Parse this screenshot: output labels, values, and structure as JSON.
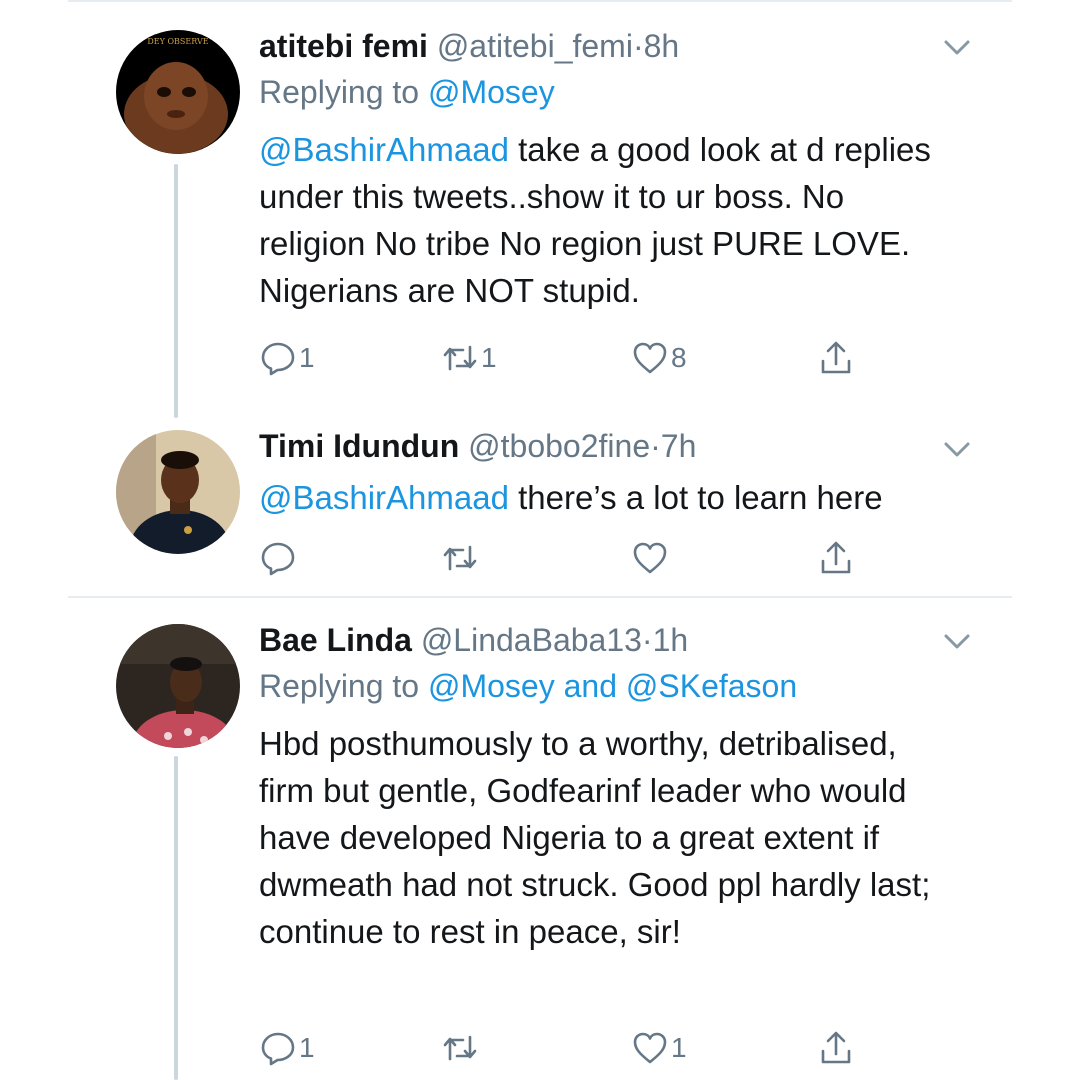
{
  "colors": {
    "link": "#1b95e0",
    "muted": "#657786",
    "text": "#14171a",
    "divider": "#e6ecf0"
  },
  "tweets": [
    {
      "name": "atitebi femi",
      "handle": "@atitebi_femi",
      "dot": "·",
      "time": "8h",
      "replying_prefix": "Replying to",
      "replying_users": "@Mosey",
      "mention": "@BashirAhmaad",
      "text": " take a good look at d replies under this tweets..show it to ur boss. No religion No tribe No region just PURE LOVE. Nigerians are NOT stupid.",
      "avatar_caption": "DEY OBSERVE",
      "reply_count": "1",
      "retweet_count": "1",
      "like_count": "8"
    },
    {
      "name": "Timi Idundun",
      "handle": "@tbobo2fine",
      "dot": "·",
      "time": "7h",
      "mention": "@BashirAhmaad",
      "text": " there’s a lot to learn here",
      "reply_count": "",
      "retweet_count": "",
      "like_count": ""
    },
    {
      "name": "Bae Linda",
      "handle": "@LindaBaba13",
      "dot": "·",
      "time": "1h",
      "replying_prefix": "Replying to",
      "replying_users": "@Mosey and @SKefason",
      "text": "Hbd posthumously to a worthy, detribalised, firm but gentle, Godfearinf leader who would have developed Nigeria to a great extent if dwmeath had not struck. Good ppl hardly last; continue to rest in peace, sir!",
      "reply_count": "1",
      "retweet_count": "",
      "like_count": "1"
    }
  ],
  "icons": {
    "reply": "reply-icon",
    "retweet": "retweet-icon",
    "like": "heart-icon",
    "share": "share-icon",
    "caret": "chevron-down-icon"
  }
}
